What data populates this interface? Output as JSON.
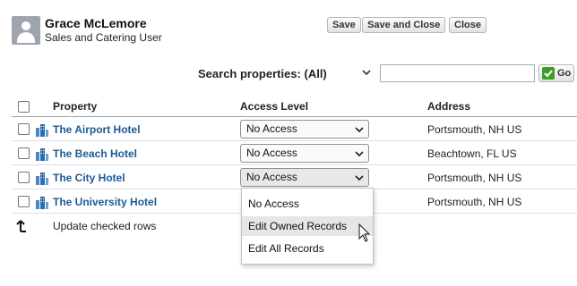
{
  "user": {
    "name": "Grace McLemore",
    "role": "Sales and Catering User"
  },
  "toolbar": {
    "save_label": "Save",
    "save_close_label": "Save and Close",
    "close_label": "Close"
  },
  "search": {
    "label": "Search properties: (All)",
    "value": "",
    "go_label": "Go"
  },
  "table": {
    "columns": {
      "property": "Property",
      "access_level": "Access Level",
      "address": "Address"
    },
    "rows": [
      {
        "property": "The Airport Hotel",
        "access": "No Access",
        "address": "Portsmouth, NH  US"
      },
      {
        "property": "The Beach Hotel",
        "access": "No Access",
        "address": "Beachtown, FL  US"
      },
      {
        "property": "The City Hotel",
        "access": "No Access",
        "address": "Portsmouth, NH  US"
      },
      {
        "property": "The University Hotel",
        "access": "No Access",
        "address": "Portsmouth, NH  US"
      }
    ],
    "update_label": "Update checked rows"
  },
  "dropdown": {
    "options": [
      "No Access",
      "Edit Owned Records",
      "Edit All Records"
    ],
    "hovered_option": "Edit Owned Records"
  },
  "icons": {
    "avatar": "user-silhouette-icon",
    "property": "building-icon",
    "update": "up-arrow-icon",
    "go": "green-checkmark-icon"
  },
  "colors": {
    "link": "#1a5a97",
    "go_check": "#3c9d2b",
    "hover": "#e6e6e6"
  }
}
